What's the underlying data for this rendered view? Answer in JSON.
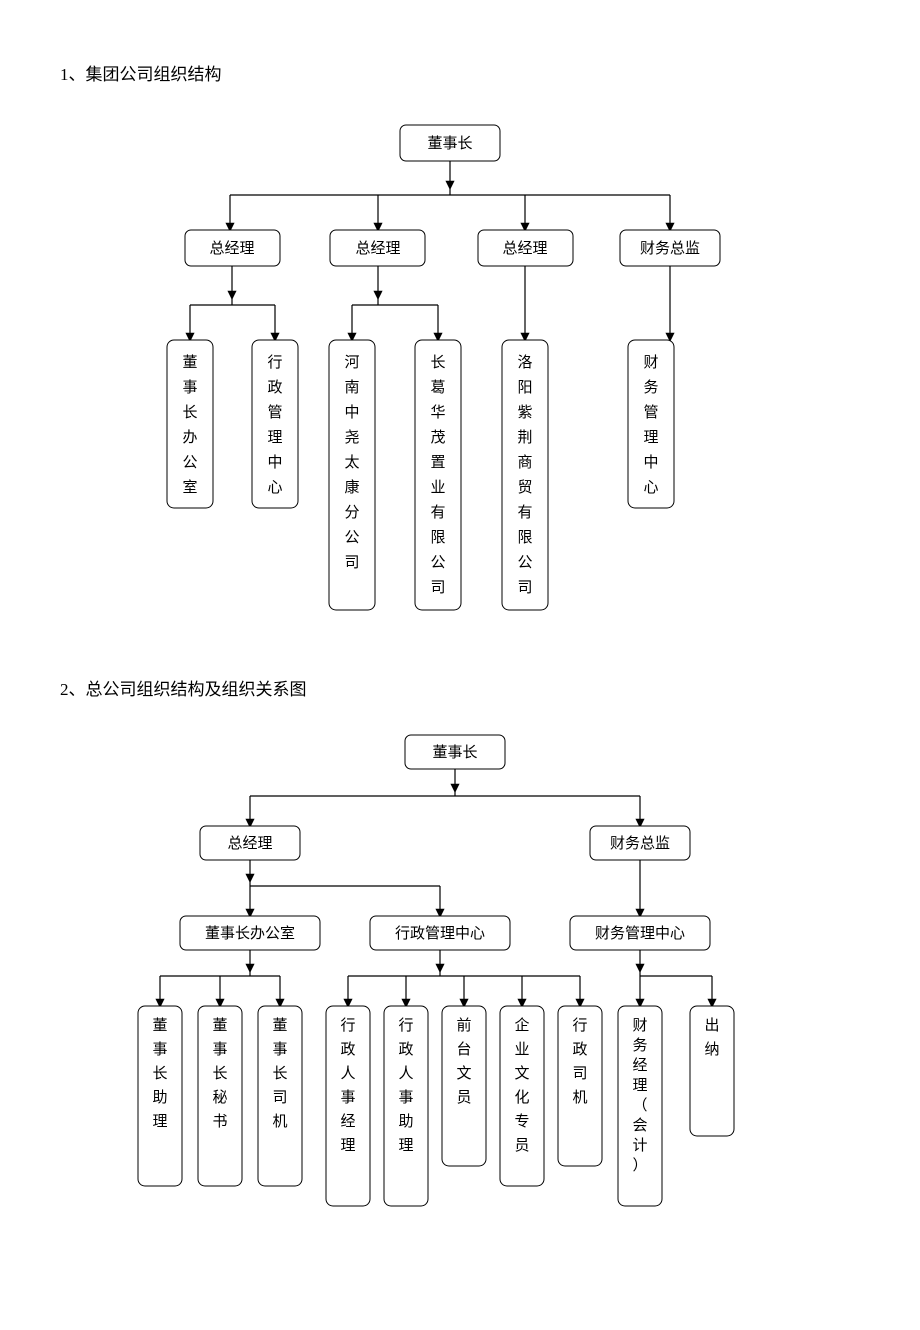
{
  "diagram1": {
    "heading": "1、集团公司组织结构",
    "root": "董事长",
    "level2": [
      "总经理",
      "总经理",
      "总经理",
      "财务总监"
    ],
    "level3": [
      "董事长办公室",
      "行政管理中心",
      "河南中尧太康分公司",
      "长葛华茂置业有限公司",
      "洛阳紫荆商贸有限公司",
      "财务管理中心"
    ]
  },
  "diagram2": {
    "heading": "2、总公司组织结构及组织关系图",
    "root": "董事长",
    "level2": [
      "总经理",
      "财务总监"
    ],
    "level3": [
      "董事长办公室",
      "行政管理中心",
      "财务管理中心"
    ],
    "level4": [
      "董事长助理",
      "董事长秘书",
      "董事长司机",
      "行政人事经理",
      "行政人事助理",
      "前台文员",
      "企业文化专员",
      "行政司机",
      "财务经理（会计）",
      "出纳"
    ]
  }
}
